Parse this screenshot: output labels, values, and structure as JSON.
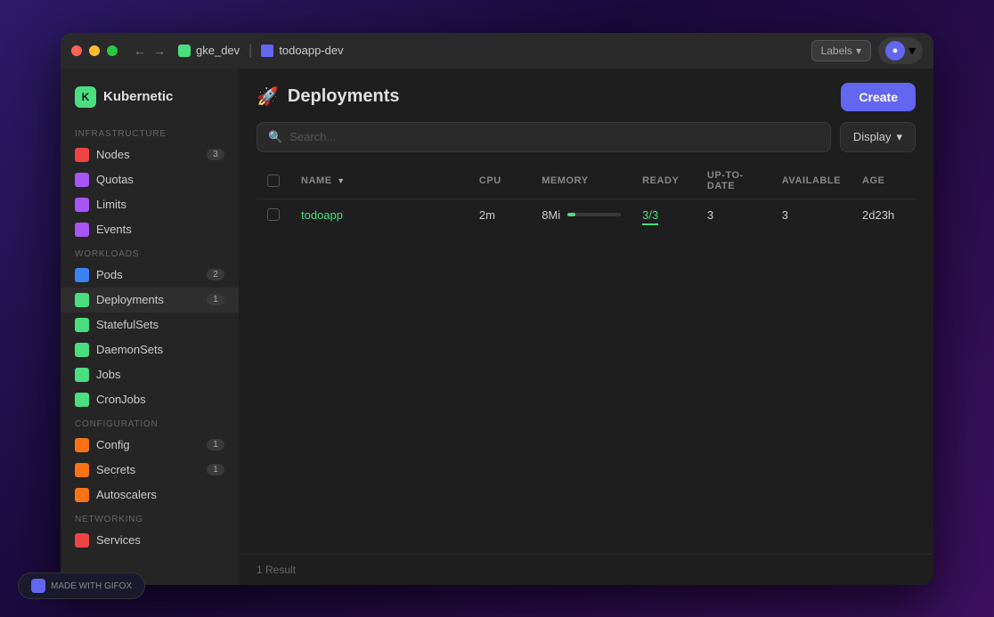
{
  "window": {
    "traffic_lights": [
      "red",
      "yellow",
      "green"
    ]
  },
  "titlebar": {
    "back_label": "←",
    "forward_label": "→",
    "cluster": "gke_dev",
    "namespace": "todoapp-dev",
    "labels_dropdown": "Labels",
    "user_icon": "U",
    "user_chevron": "▾"
  },
  "sidebar": {
    "brand": "Kubernetic",
    "sections": [
      {
        "label": "Infrastructure",
        "items": [
          {
            "id": "nodes",
            "label": "Nodes",
            "badge": "3",
            "icon_class": "icon-nodes"
          },
          {
            "id": "quotas",
            "label": "Quotas",
            "badge": null,
            "icon_class": "icon-quotas"
          },
          {
            "id": "limits",
            "label": "Limits",
            "badge": null,
            "icon_class": "icon-limits"
          },
          {
            "id": "events",
            "label": "Events",
            "badge": null,
            "icon_class": "icon-events"
          }
        ]
      },
      {
        "label": "Workloads",
        "items": [
          {
            "id": "pods",
            "label": "Pods",
            "badge": "2",
            "icon_class": "icon-pods"
          },
          {
            "id": "deployments",
            "label": "Deployments",
            "badge": "1",
            "icon_class": "icon-deployments",
            "active": true
          },
          {
            "id": "statefulsets",
            "label": "StatefulSets",
            "badge": null,
            "icon_class": "icon-statefulsets"
          },
          {
            "id": "daemonsets",
            "label": "DaemonSets",
            "badge": null,
            "icon_class": "icon-daemonsets"
          },
          {
            "id": "jobs",
            "label": "Jobs",
            "badge": null,
            "icon_class": "icon-jobs"
          },
          {
            "id": "cronjobs",
            "label": "CronJobs",
            "badge": null,
            "icon_class": "icon-cronjobs"
          }
        ]
      },
      {
        "label": "Configuration",
        "items": [
          {
            "id": "config",
            "label": "Config",
            "badge": "1",
            "icon_class": "icon-config"
          },
          {
            "id": "secrets",
            "label": "Secrets",
            "badge": "1",
            "icon_class": "icon-secrets"
          },
          {
            "id": "autoscalers",
            "label": "Autoscalers",
            "badge": null,
            "icon_class": "icon-autoscalers"
          }
        ]
      },
      {
        "label": "Networking",
        "items": [
          {
            "id": "services",
            "label": "Services",
            "badge": null,
            "icon_class": "icon-services"
          }
        ]
      }
    ]
  },
  "main": {
    "page_title": "Deployments",
    "create_button": "Create",
    "search_placeholder": "Search...",
    "display_button": "Display",
    "table": {
      "columns": [
        "NAME",
        "CPU",
        "MEMORY",
        "READY",
        "UP-TO-DATE",
        "AVAILABLE",
        "AGE"
      ],
      "rows": [
        {
          "name": "todoapp",
          "cpu": "2m",
          "memory": "8Mi",
          "memory_pct": 15,
          "ready": "3/3",
          "uptodate": "3",
          "available": "3",
          "age": "2d23h"
        }
      ]
    },
    "footer": "1 Result"
  },
  "gifox": {
    "label": "MADE WITH GIFOX"
  }
}
